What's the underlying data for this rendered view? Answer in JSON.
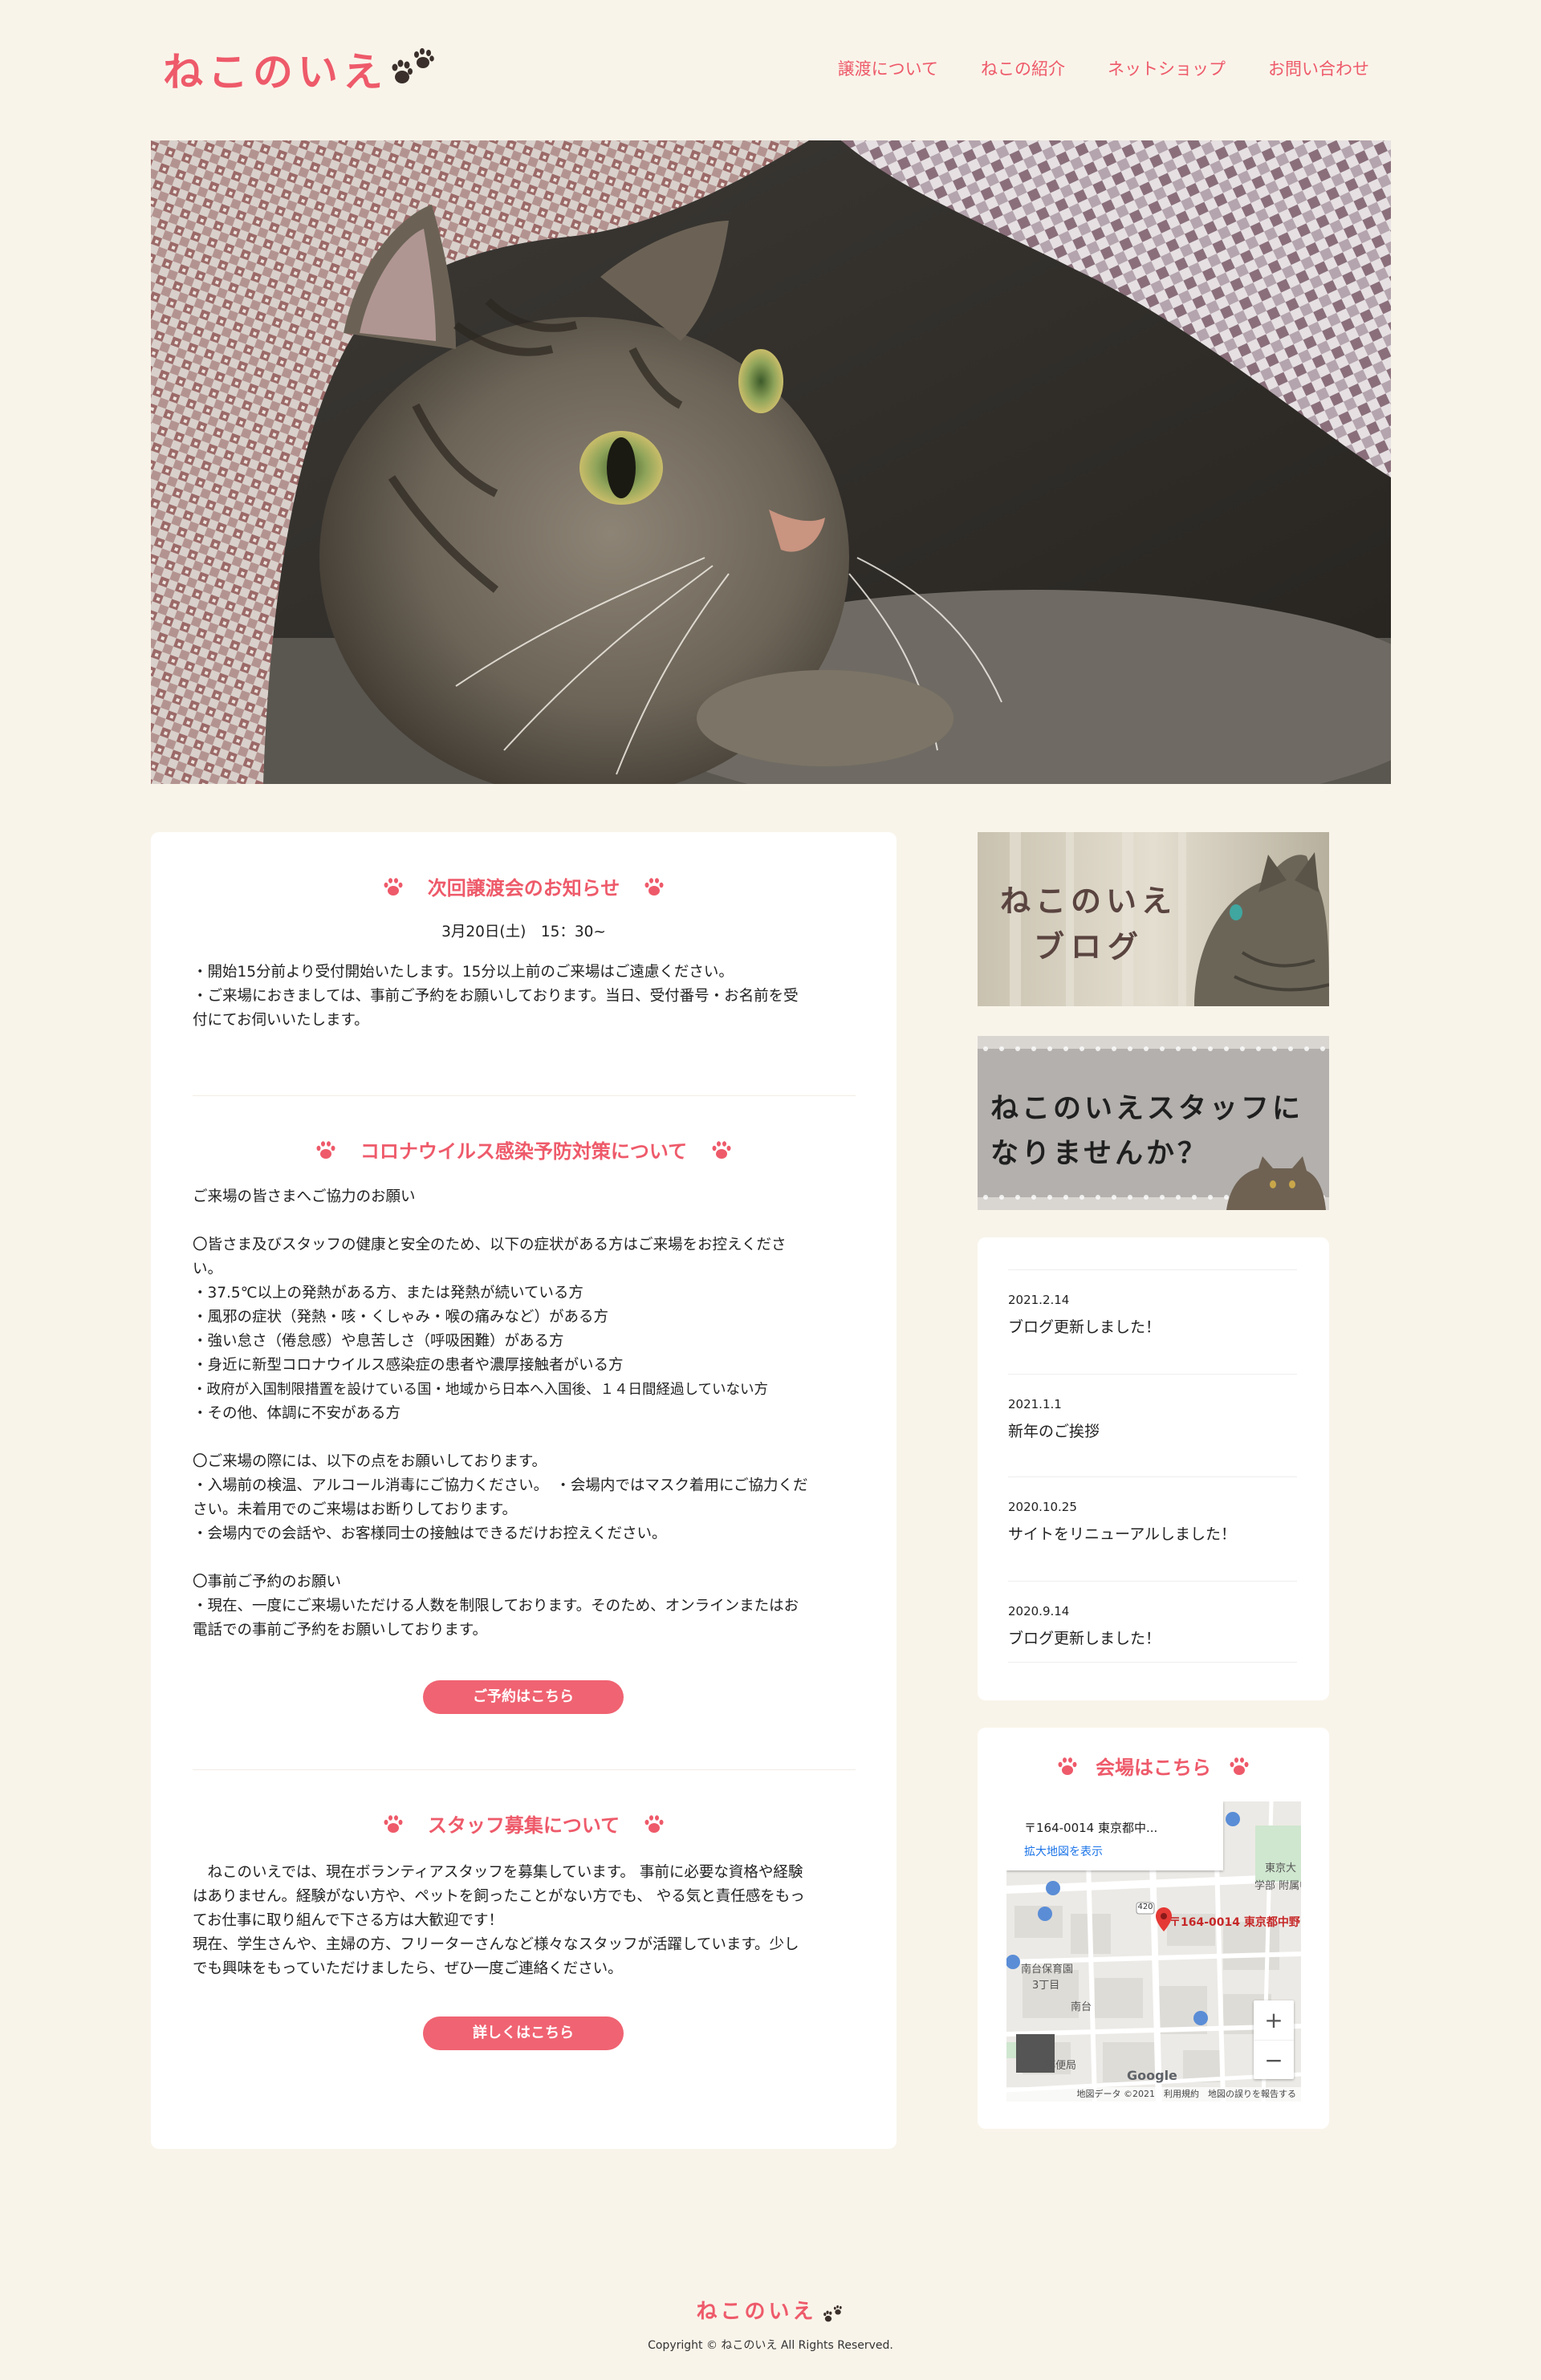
{
  "brand": {
    "name": "ねこのいえ",
    "accent": "#ee5a6a"
  },
  "nav": [
    {
      "label": "譲渡について"
    },
    {
      "label": "ねこの紹介"
    },
    {
      "label": "ネットショップ"
    },
    {
      "label": "お問い合わせ"
    }
  ],
  "hero": {
    "alt": "tabby-cat-under-blanket"
  },
  "notice": {
    "title": "次回譲渡会のお知らせ",
    "date": "3月20日(土)　15：30~",
    "lines": [
      "・開始15分前より受付開始いたします。15分以上前のご来場はご遠慮ください。",
      "・ご来場におきましては、事前ご予約をお願いしております。当日、受付番号・お名前を受",
      "付にてお伺いいたします。"
    ]
  },
  "corona": {
    "title": "コロナウイルス感染予防対策について",
    "lines": [
      "ご来場の皆さまへご協力のお願い",
      "",
      "〇皆さま及びスタッフの健康と安全のため、以下の症状がある方はご来場をお控えくださ",
      "い。",
      "・37.5℃以上の発熱がある方、または発熱が続いている方",
      "・風邪の症状（発熱・咳・くしゃみ・喉の痛みなど）がある方",
      "・強い怠さ（倦怠感）や息苦しさ（呼吸困難）がある方",
      "・身近に新型コロナウイルス感染症の患者や濃厚接触者がいる方",
      "・政府が入国制限措置を設けている国・地域から日本へ入国後、１４日間経過していない方",
      "・その他、体調に不安がある方",
      "",
      "〇ご来場の際には、以下の点をお願いしております。",
      "・入場前の検温、アルコール消毒にご協力ください。　・会場内ではマスク着用にご協力くだ",
      "さい。未着用でのご来場はお断りしております。",
      "・会場内での会話や、お客様同士の接触はできるだけお控えください。",
      "",
      "〇事前ご予約のお願い",
      "・現在、一度にご来場いただける人数を制限しております。そのため、オンラインまたはお",
      "電話での事前ご予約をお願いしております。"
    ],
    "button": "ご予約はこちら"
  },
  "staff": {
    "title": "スタッフ募集について",
    "lines": [
      "　ねこのいえでは、現在ボランティアスタッフを募集しています。 事前に必要な資格や経験",
      "はありません。経験がない方や、ペットを飼ったことがない方でも、 やる気と責任感をもっ",
      "てお仕事に取り組んで下さる方は大歓迎です！",
      "現在、学生さんや、主婦の方、フリーターさんなど様々なスタッフが活躍しています。少し",
      "でも興味をもっていただけましたら、ぜひ一度ご連絡ください。"
    ],
    "button": "詳しくはこちら"
  },
  "banners": {
    "blog_line1": "ねこのいえ",
    "blog_line2": "ブログ",
    "staff_line1": "ねこのいえスタッフに",
    "staff_line2": "なりませんか？"
  },
  "news": [
    {
      "date": "2021.2.14",
      "title": "ブログ更新しました！"
    },
    {
      "date": "2021.1.1",
      "title": "新年のご挨拶"
    },
    {
      "date": "2020.10.25",
      "title": "サイトをリニューアルしました！"
    },
    {
      "date": "2020.9.14",
      "title": "ブログ更新しました！"
    }
  ],
  "venue": {
    "title": "会場はこちら",
    "map": {
      "address_short": "〒164-0014 東京都中...",
      "enlarge": "拡大地図を表示",
      "pin_label": "〒164-0014 東京都中野",
      "labels": [
        "学部 附属中",
        "南台保育園",
        "3丁目",
        "南台",
        "東京大",
        "郵便局"
      ],
      "road": "420",
      "zoom_in": "+",
      "zoom_out": "−",
      "google": "Google",
      "attribution": "地図データ ©2021　利用規約　地図の誤りを報告する"
    }
  },
  "footer": {
    "logo": "ねこのいえ",
    "copyright": "Copyright © ねこのいえ All Rights Reserved."
  }
}
